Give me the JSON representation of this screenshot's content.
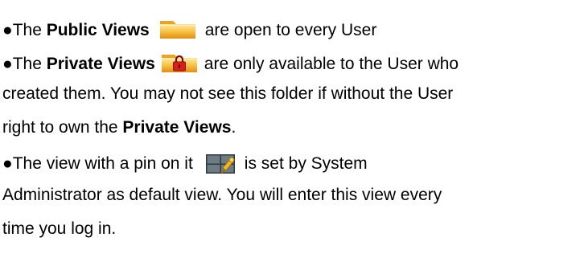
{
  "bullet": "●",
  "lines": {
    "l1": {
      "pre": "The ",
      "bold": "Public Views",
      "post": "are open to every User"
    },
    "l2": {
      "pre": "The ",
      "bold": "Private Views",
      "post": "are only available to the User who"
    },
    "l3": {
      "text": "created them. You may not see this folder if without the User"
    },
    "l4": {
      "pre": "right to own the ",
      "bold": "Private Views",
      "post": "."
    },
    "l5": {
      "pre": "The view with a pin on it",
      "post": "is set by System"
    },
    "l6": {
      "text": "Administrator as default view. You will enter this view every"
    },
    "l7": {
      "text": "time you log in."
    }
  },
  "icons": {
    "public": "folder-icon",
    "private": "locked-folder-icon",
    "default_view": "pinned-view-icon"
  },
  "colors": {
    "folder_light": "#f9cf5a",
    "folder_dark": "#e59a1a",
    "lock_red": "#d8201a",
    "view_grey": "#5f6a70"
  }
}
